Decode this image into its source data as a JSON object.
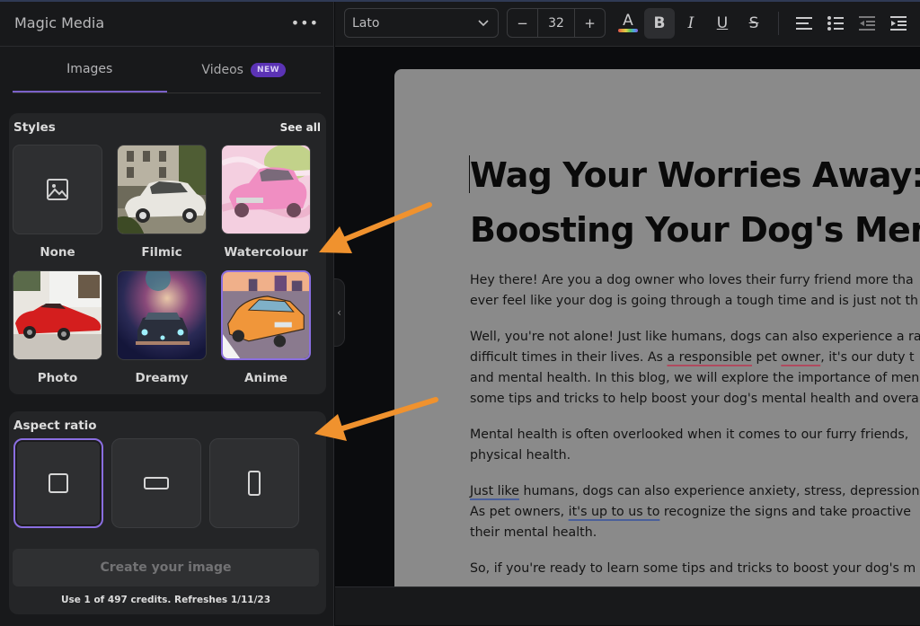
{
  "panel": {
    "title": "Magic Media",
    "more_icon": "more-horizontal-icon"
  },
  "tabs": [
    {
      "label": "Images",
      "active": true
    },
    {
      "label": "Videos",
      "badge": "NEW",
      "active": false
    }
  ],
  "styles": {
    "title": "Styles",
    "see_all": "See all",
    "items": [
      {
        "label": "None",
        "selected": false,
        "thumb": "image-placeholder-icon"
      },
      {
        "label": "Filmic",
        "selected": false,
        "thumb": "vintage-white-car"
      },
      {
        "label": "Watercolour",
        "selected": false,
        "thumb": "pink-watercolour-car"
      },
      {
        "label": "Photo",
        "selected": false,
        "thumb": "red-sports-car-photo"
      },
      {
        "label": "Dreamy",
        "selected": false,
        "thumb": "car-in-nebula"
      },
      {
        "label": "Anime",
        "selected": true,
        "thumb": "orange-anime-hatchback"
      }
    ]
  },
  "aspect_ratio": {
    "title": "Aspect ratio",
    "options": [
      {
        "name": "square",
        "icon": "square-icon",
        "selected": true
      },
      {
        "name": "landscape",
        "icon": "landscape-rect-icon",
        "selected": false
      },
      {
        "name": "portrait",
        "icon": "portrait-rect-icon",
        "selected": false
      }
    ]
  },
  "create_button": "Create your image",
  "credits_text": "Use 1 of 497 credits. Refreshes 1/11/23",
  "toolbar": {
    "font": "Lato",
    "font_size": "32",
    "decrease": "−",
    "increase": "+",
    "tools": [
      "text-color",
      "bold",
      "italic",
      "underline",
      "strikethrough",
      "align-left",
      "bulleted-list",
      "decrease-indent",
      "increase-indent"
    ],
    "bold_active": true
  },
  "document": {
    "title_line1": "Wag Your Worries Away: T",
    "title_line2": "Boosting Your Dog's Ment",
    "p1_l1": "Hey there! Are you a dog owner who loves their furry friend more tha",
    "p1_l2": "ever feel like your dog is going through a tough time and is just not th",
    "p2_l1": "Well, you're not alone! Just like humans, dogs can also experience a ra",
    "p2_l2a": "difficult times in their lives. As ",
    "p2_l2b": "a responsible",
    "p2_l2c": " pet ",
    "p2_l2d": "owner",
    "p2_l2e": ", it's our duty t",
    "p2_l3": "and mental health. In this blog, we will explore the importance of men",
    "p2_l4": "some tips and tricks to help boost your dog's mental health and overa",
    "p3_l1": "Mental health is often overlooked when it comes to our furry friends,",
    "p3_l2": "physical health.",
    "p4_l1a": "Just like",
    "p4_l1b": " humans, dogs can also experience anxiety, stress, depression",
    "p4_l2a": "As pet owners, ",
    "p4_l2b": "it's up to us to",
    "p4_l2c": " recognize the signs and take proactive",
    "p4_l3": "their mental health.",
    "p5_l1": "So, if you're ready to learn some tips and tricks to boost your dog's m"
  },
  "colors": {
    "accent": "#8a6ee0",
    "badge": "#5b33b5",
    "annotation_arrow": "#f0922e",
    "panel_bg": "#18191b",
    "page_bg": "#8a8a8a"
  }
}
